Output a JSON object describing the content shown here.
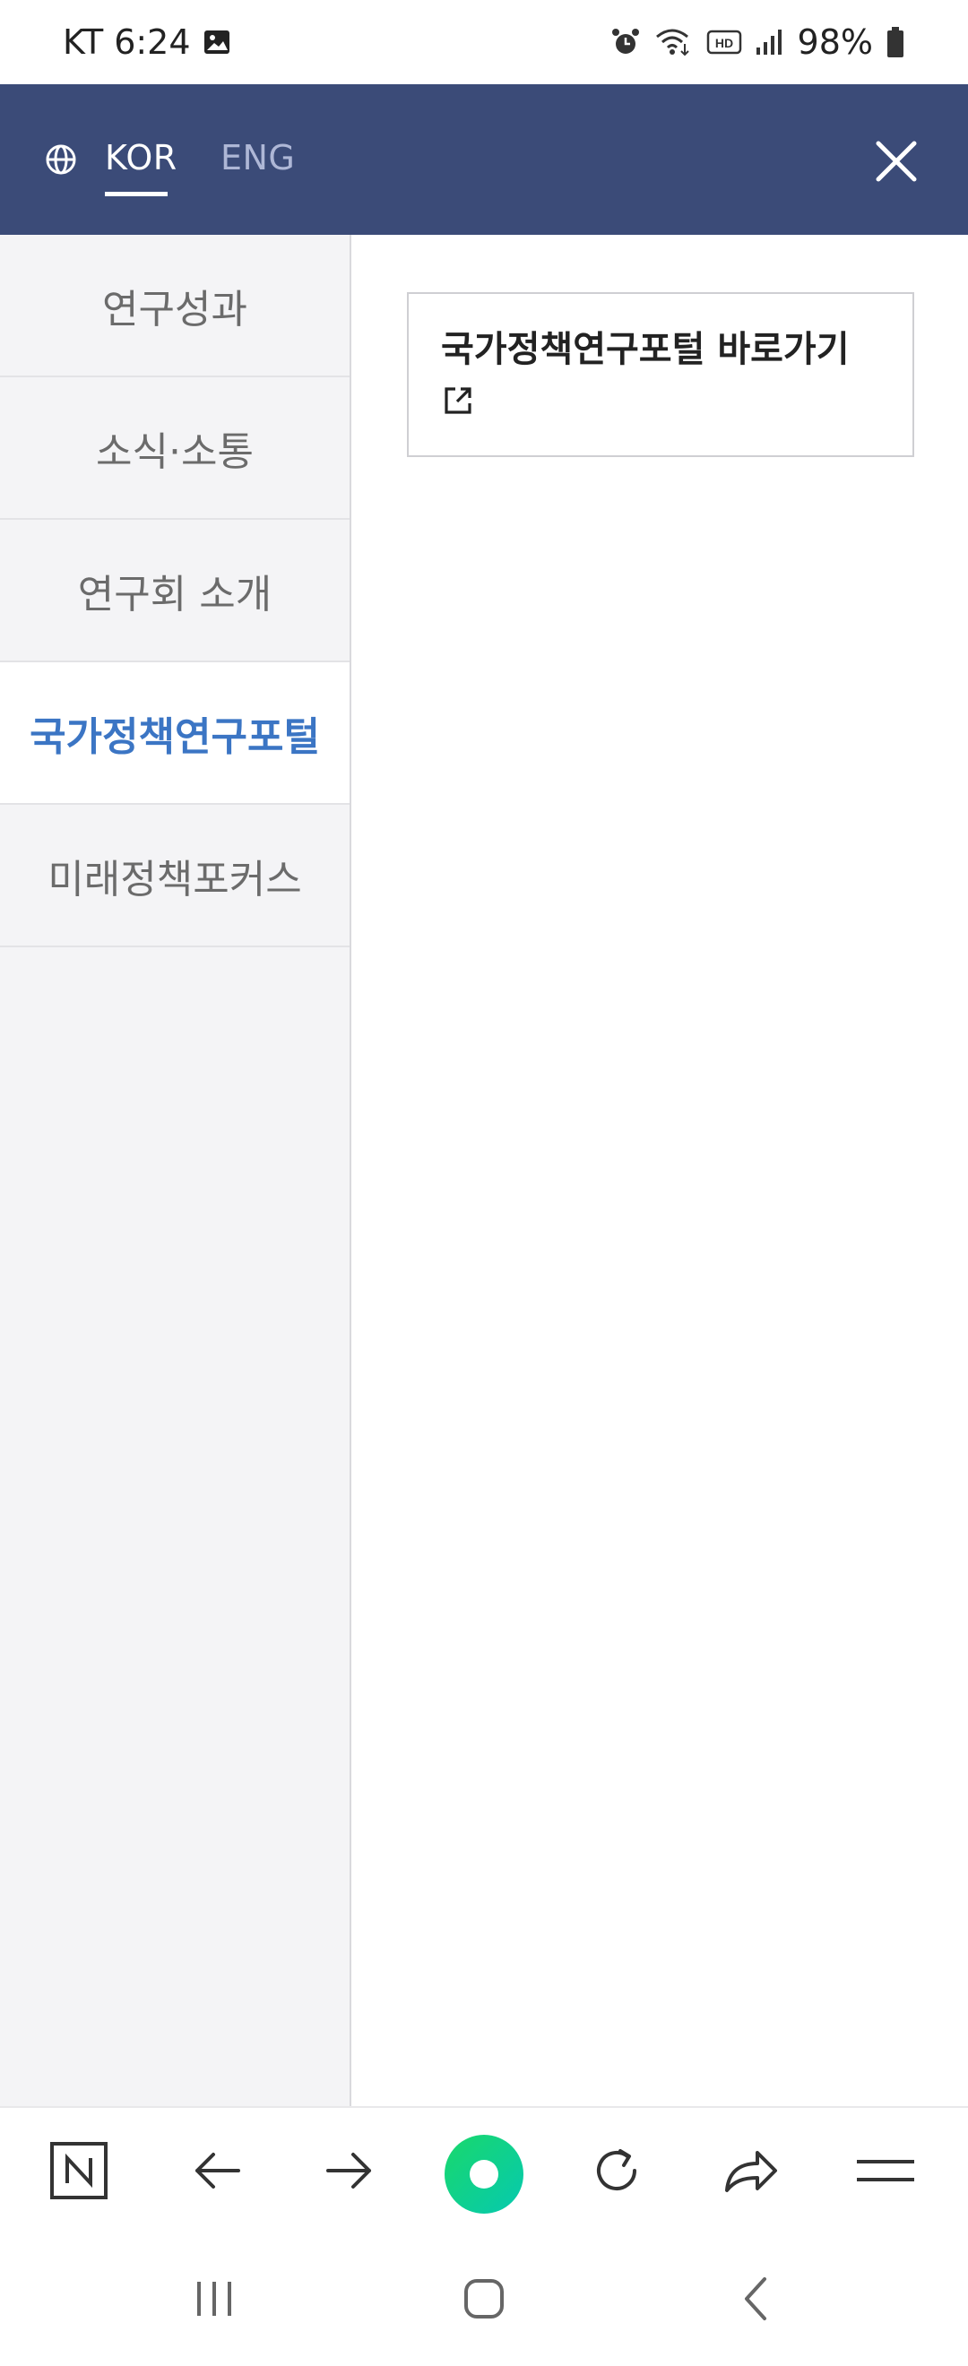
{
  "status_bar": {
    "carrier": "KT",
    "time": "6:24",
    "battery": "98%",
    "icons": [
      "image-icon",
      "alarm-icon",
      "wifi-icon",
      "hd-icon",
      "signal-icon",
      "battery-icon"
    ]
  },
  "header": {
    "languages": [
      {
        "label": "KOR",
        "selected": true
      },
      {
        "label": "ENG",
        "selected": false
      }
    ],
    "icons": [
      "globe-icon",
      "close-icon"
    ]
  },
  "menu": {
    "items": [
      {
        "label": "연구성과",
        "active": false
      },
      {
        "label": "소식·소통",
        "active": false
      },
      {
        "label": "연구회 소개",
        "active": false
      },
      {
        "label": "국가정책연구포털",
        "active": true
      },
      {
        "label": "미래정책포커스",
        "active": false
      }
    ]
  },
  "content": {
    "link_label": "국가정책연구포털 바로가기",
    "link_icon": "external-link-icon"
  },
  "browser_toolbar": {
    "icons": [
      "naver-n-icon",
      "back-arrow-icon",
      "forward-arrow-icon",
      "green-home-icon",
      "refresh-icon",
      "share-icon",
      "menu-icon"
    ]
  },
  "nav_bar": {
    "icons": [
      "recent-apps-icon",
      "home-icon",
      "back-icon"
    ]
  },
  "colors": {
    "header_bg": "#3b4b78",
    "active_menu_text": "#3b75c4",
    "menu_bg": "#f4f4f6",
    "green_button": "#19d86b"
  }
}
